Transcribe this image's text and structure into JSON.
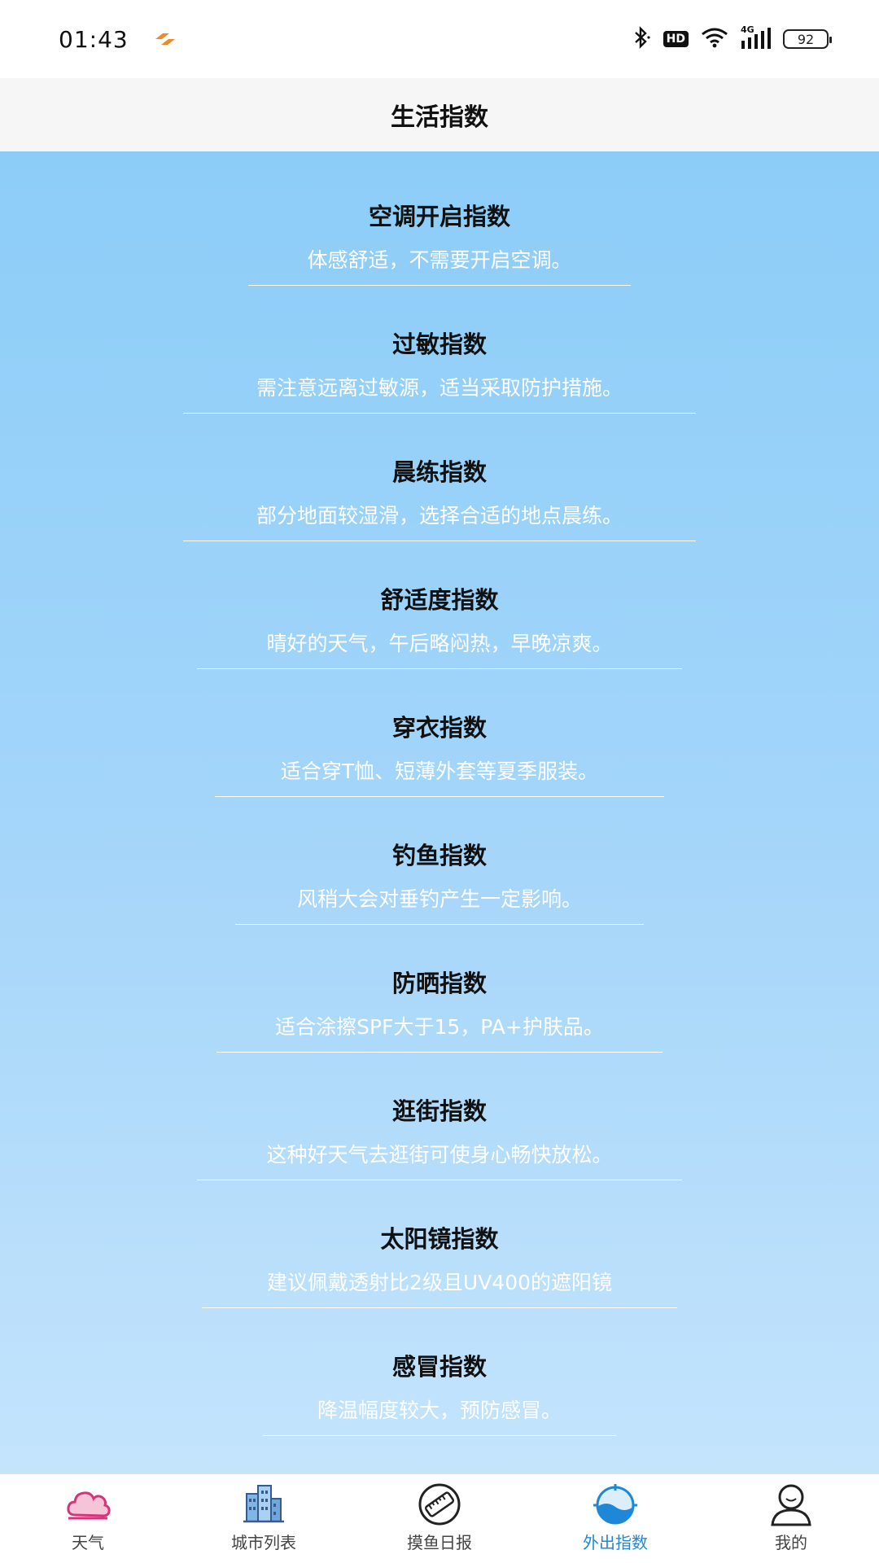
{
  "status_bar": {
    "time": "01:43",
    "battery": "92",
    "hd_label": "HD",
    "network_label": "4G"
  },
  "header": {
    "title": "生活指数"
  },
  "indices": [
    {
      "title": "空调开启指数",
      "desc": "体感舒适，不需要开启空调。"
    },
    {
      "title": "过敏指数",
      "desc": "需注意远离过敏源，适当采取防护措施。"
    },
    {
      "title": "晨练指数",
      "desc": "部分地面较湿滑，选择合适的地点晨练。"
    },
    {
      "title": "舒适度指数",
      "desc": "晴好的天气，午后略闷热，早晚凉爽。"
    },
    {
      "title": "穿衣指数",
      "desc": "适合穿T恤、短薄外套等夏季服装。"
    },
    {
      "title": "钓鱼指数",
      "desc": "风稍大会对垂钓产生一定影响。"
    },
    {
      "title": "防晒指数",
      "desc": "适合涂擦SPF大于15，PA+护肤品。"
    },
    {
      "title": "逛街指数",
      "desc": "这种好天气去逛街可使身心畅快放松。"
    },
    {
      "title": "太阳镜指数",
      "desc": "建议佩戴透射比2级且UV400的遮阳镜"
    },
    {
      "title": "感冒指数",
      "desc": "降温幅度较大，预防感冒。"
    }
  ],
  "tabs": [
    {
      "label": "天气",
      "icon": "cloud-icon",
      "active": false
    },
    {
      "label": "城市列表",
      "icon": "city-buildings-icon",
      "active": false
    },
    {
      "label": "摸鱼日报",
      "icon": "ruler-icon",
      "active": false
    },
    {
      "label": "外出指数",
      "icon": "globe-icon",
      "active": true
    },
    {
      "label": "我的",
      "icon": "user-icon",
      "active": false
    }
  ],
  "colors": {
    "accent": "#1e88d8",
    "content_top": "#8ccdf8",
    "content_bottom": "#c4e4fc",
    "weather_icon": "#d6337a"
  }
}
